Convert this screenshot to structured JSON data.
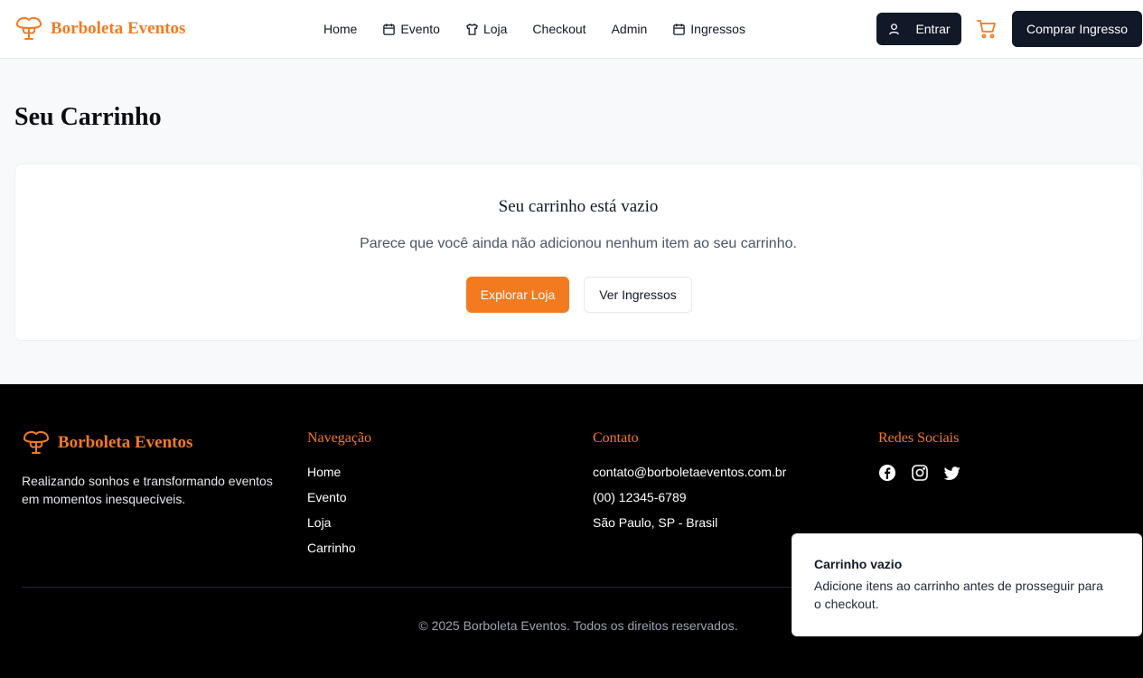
{
  "header": {
    "brand": "Borboleta Eventos",
    "nav": [
      {
        "label": "Home",
        "icon": ""
      },
      {
        "label": "Evento",
        "icon": "calendar-icon"
      },
      {
        "label": "Loja",
        "icon": "shirt-icon"
      },
      {
        "label": "Checkout",
        "icon": ""
      },
      {
        "label": "Admin",
        "icon": ""
      },
      {
        "label": "Ingressos",
        "icon": "calendar-icon"
      }
    ],
    "login_label": "Entrar",
    "buy_label": "Comprar Ingresso"
  },
  "main": {
    "title": "Seu Carrinho",
    "empty_title": "Seu carrinho está vazio",
    "empty_subtitle": "Parece que você ainda não adicionou nenhum item ao seu carrinho.",
    "explore_label": "Explorar Loja",
    "tickets_label": "Ver Ingressos"
  },
  "footer": {
    "brand": "Borboleta Eventos",
    "tagline": "Realizando sonhos e transformando eventos em momentos inesquecíveis.",
    "nav_title": "Navegação",
    "nav_links": [
      "Home",
      "Evento",
      "Loja",
      "Carrinho"
    ],
    "contact_title": "Contato",
    "contact": [
      "contato@borboletaeventos.com.br",
      "(00) 12345-6789",
      "São Paulo, SP - Brasil"
    ],
    "social_title": "Redes Sociais",
    "social": [
      "facebook-icon",
      "instagram-icon",
      "twitter-icon"
    ],
    "copyright": "© 2025 Borboleta Eventos. Todos os direitos reservados."
  },
  "toast": {
    "title": "Carrinho vazio",
    "description": "Adicione itens ao carrinho antes de prosseguir para o checkout."
  },
  "colors": {
    "accent": "#f47a20",
    "dark": "#111827",
    "background": "#f8f9fb",
    "footer_bg": "#000000"
  }
}
